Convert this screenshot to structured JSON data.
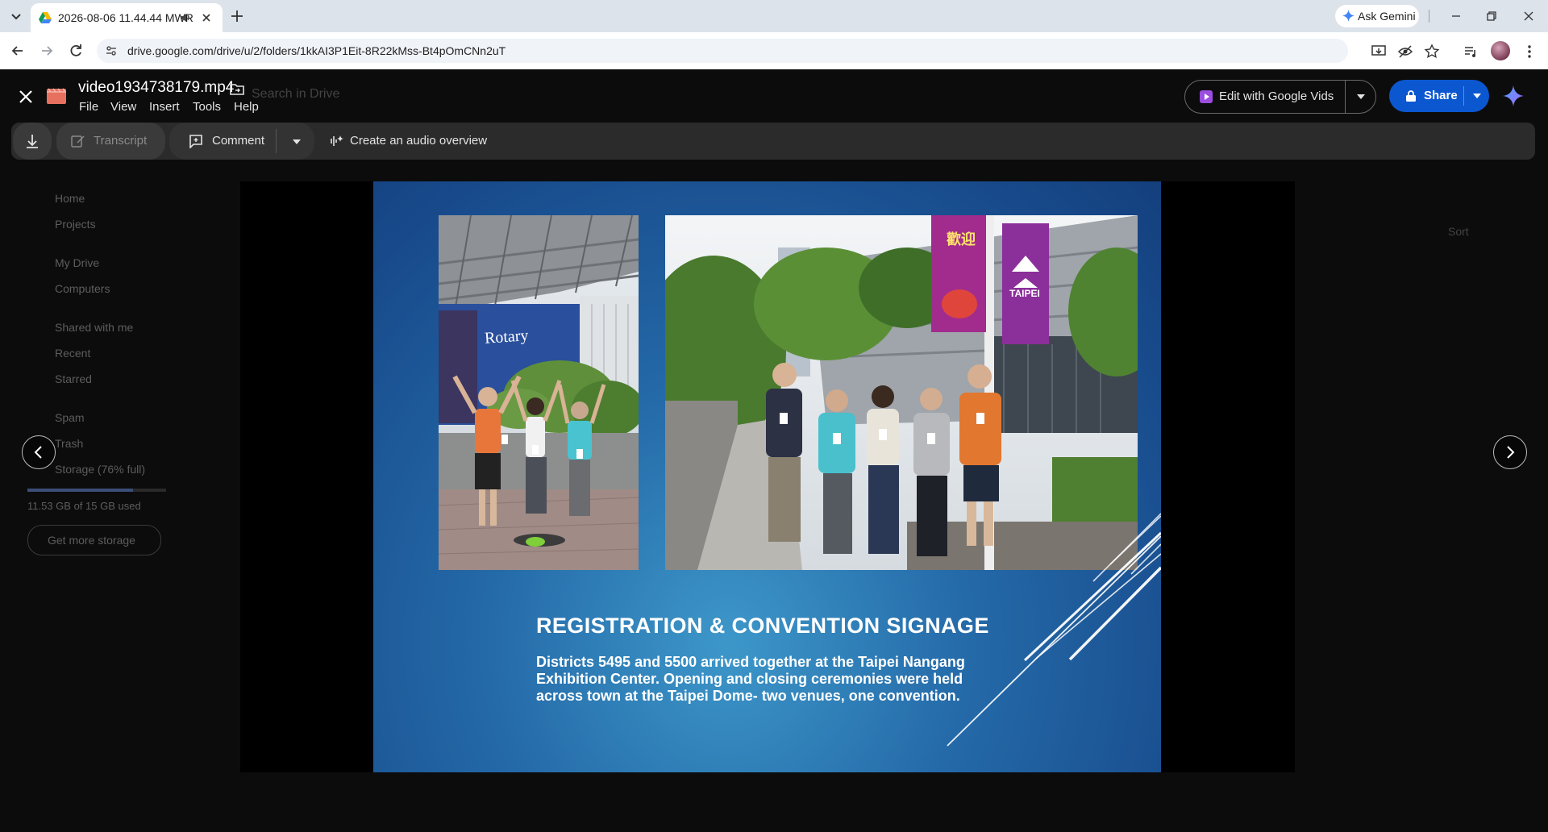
{
  "browser": {
    "tab_title": "2026-08-06 11.44.44 MWR",
    "ask_gemini": "Ask Gemini",
    "url": "drive.google.com/drive/u/2/folders/1kkAI3P1Eit-8R22kMss-Bt4pOmCNn2uT"
  },
  "background_drive": {
    "search_placeholder": "Search in Drive",
    "sidebar": {
      "items": [
        "Home",
        "Projects",
        "My Drive",
        "Computers",
        "Shared with me",
        "Recent",
        "Starred",
        "Spam",
        "Trash",
        "Storage (76% full)"
      ],
      "storage_used": "11.53 GB of 15 GB used",
      "storage_fraction": 0.76,
      "get_more_storage": "Get more storage"
    },
    "sort_label": "Sort"
  },
  "viewer": {
    "file_name": "video1934738179.mp4",
    "menu": [
      "File",
      "View",
      "Insert",
      "Tools",
      "Help"
    ],
    "edit_vids_label": "Edit with Google Vids",
    "share_label": "Share",
    "toolbar": {
      "transcript": "Transcript",
      "comment": "Comment",
      "audio_overview": "Create an audio overview"
    }
  },
  "slide": {
    "title": "REGISTRATION & CONVENTION SIGNAGE",
    "body": "Districts 5495 and 5500 arrived together at the Taipei Nangang\nExhibition Center. Opening and closing ceremonies were held\nacross town at the Taipei Dome- two venues, one convention.",
    "photo1_sign": "Rotary",
    "banner1": "歡迎",
    "banner2": "TAIPEI"
  },
  "colors": {
    "accent_blue": "#0b57d0",
    "share_button": "#0b57d0",
    "slide_blue": "#1d5596"
  }
}
